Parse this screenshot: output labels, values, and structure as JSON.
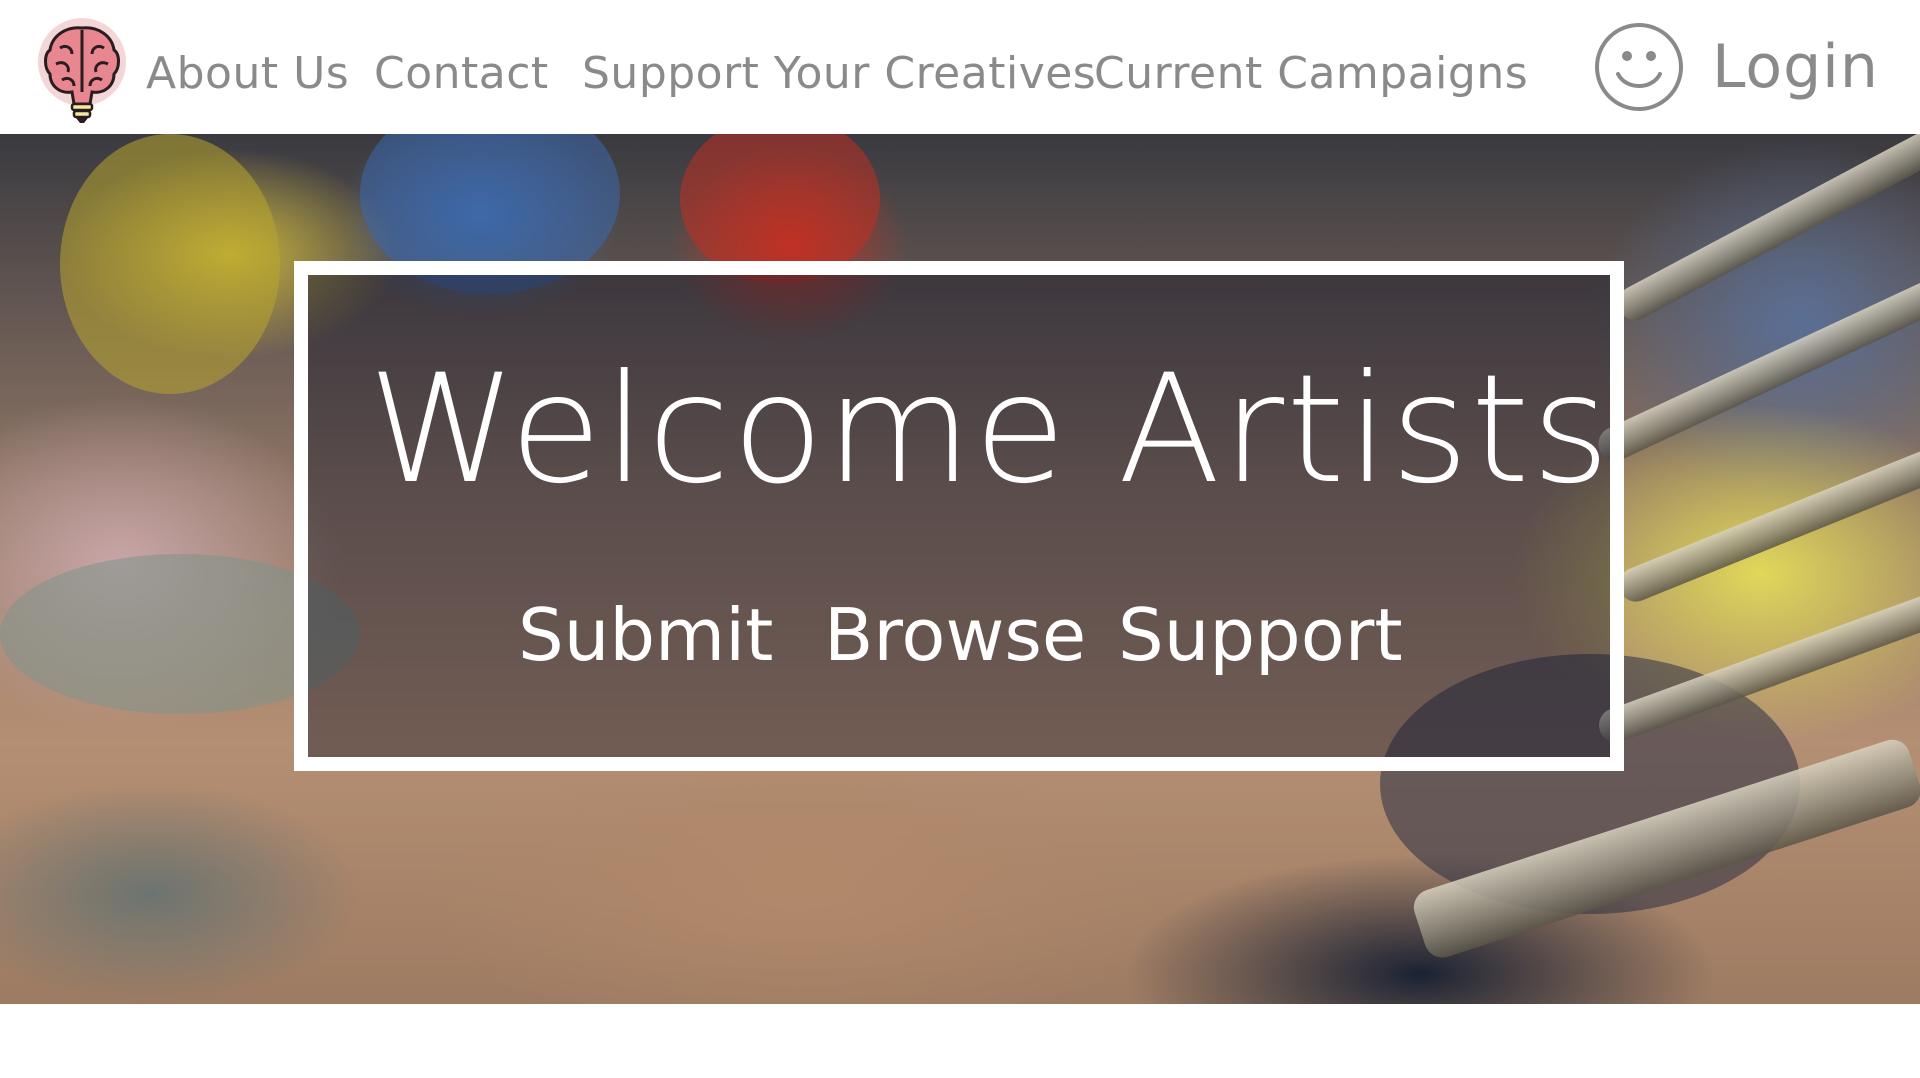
{
  "nav": {
    "logo_icon": "brain-icon",
    "links": [
      {
        "label": "About Us"
      },
      {
        "label": "Contact"
      },
      {
        "label": "Support Your Creatives"
      },
      {
        "label": "Current Campaigns"
      }
    ],
    "avatar_icon": "smiley-face-icon",
    "login_label": "Login"
  },
  "hero": {
    "title": "Welcome Artists",
    "actions": [
      {
        "label": "Submit"
      },
      {
        "label": "Browse"
      },
      {
        "label": "Support"
      }
    ],
    "background_image": "paint-tubes-and-brushes-photo"
  },
  "colors": {
    "nav_text": "#8a8a8a",
    "hero_text": "#ffffff",
    "frame_border": "#ffffff",
    "logo_pink": "#e8878f"
  }
}
